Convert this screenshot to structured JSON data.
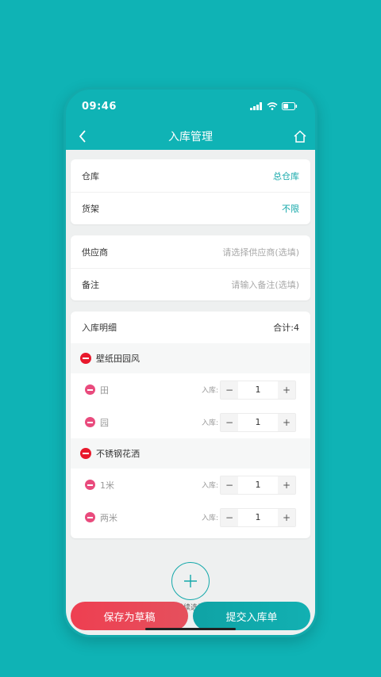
{
  "status_bar": {
    "time": "09:46"
  },
  "nav": {
    "title": "入库管理"
  },
  "warehouse_card": {
    "warehouse_label": "仓库",
    "warehouse_value": "总仓库",
    "shelf_label": "货架",
    "shelf_value": "不限"
  },
  "supplier_card": {
    "supplier_label": "供应商",
    "supplier_placeholder": "请选择供应商(选填)",
    "remark_label": "备注",
    "remark_placeholder": "请输入备注(选填)"
  },
  "detail": {
    "title": "入库明细",
    "total": "合计:4",
    "qty_label": "入库:",
    "products": [
      {
        "name": "壁纸田园风",
        "variants": [
          {
            "name": "田",
            "qty": "1"
          },
          {
            "name": "园",
            "qty": "1"
          }
        ]
      },
      {
        "name": "不锈钢花洒",
        "variants": [
          {
            "name": "1米",
            "qty": "1"
          },
          {
            "name": "两米",
            "qty": "1"
          }
        ]
      }
    ]
  },
  "add": {
    "label": "继续选择"
  },
  "actions": {
    "draft_label": "保存为草稿",
    "submit_label": "提交入库单"
  },
  "colors": {
    "accent": "#14a8aa",
    "background": "#0fb3b5",
    "danger": "#e8192c",
    "draft_button": "#ee3f51"
  }
}
